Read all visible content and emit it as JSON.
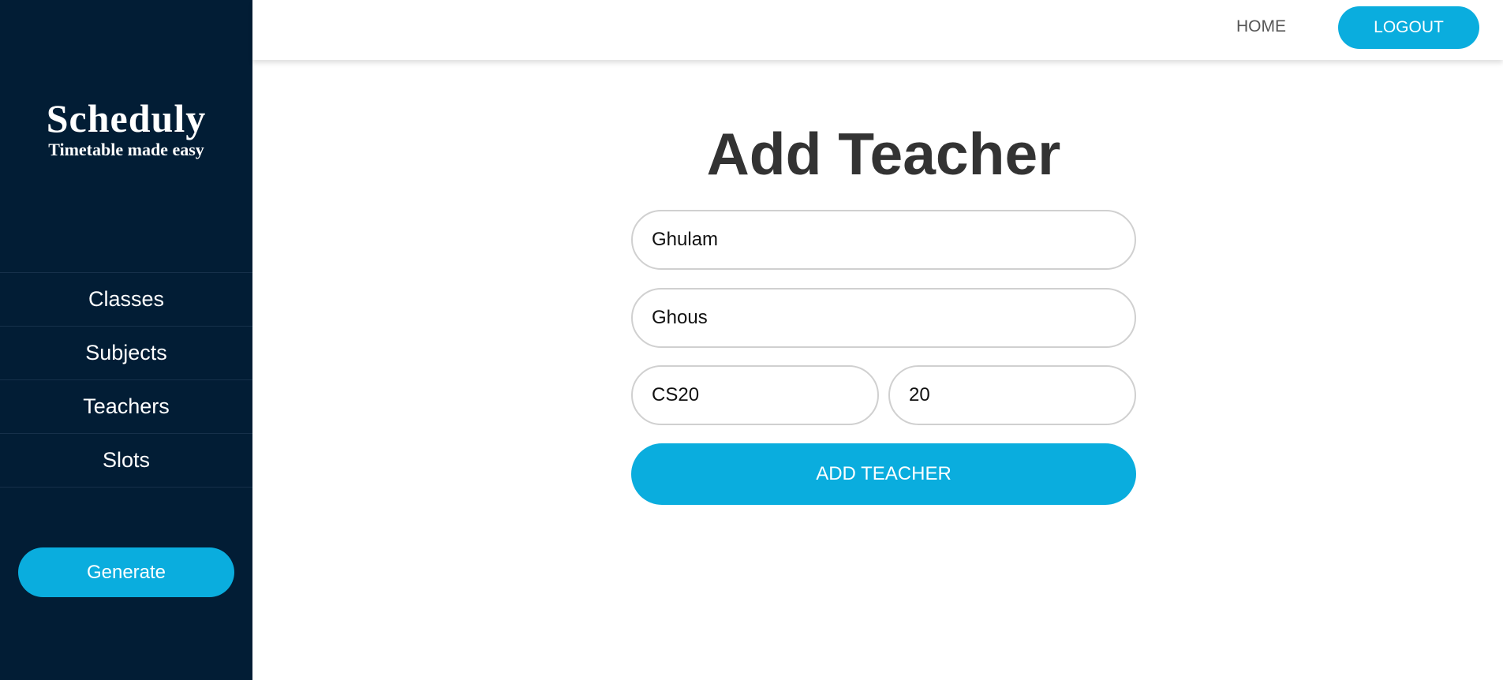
{
  "sidebar": {
    "brand_name": "Scheduly",
    "tagline": "Timetable made easy",
    "items": [
      {
        "label": "Classes"
      },
      {
        "label": "Subjects"
      },
      {
        "label": "Teachers"
      },
      {
        "label": "Slots"
      }
    ],
    "generate_label": "Generate"
  },
  "header": {
    "home_label": "HOME",
    "logout_label": "LOGOUT"
  },
  "main": {
    "title": "Add Teacher",
    "form": {
      "first_name": "Ghulam",
      "last_name": "Ghous",
      "code": "CS20",
      "number": "20",
      "submit_label": "ADD TEACHER"
    }
  },
  "colors": {
    "sidebar_bg": "#021d35",
    "accent": "#0aadde",
    "title_text": "#333333"
  }
}
